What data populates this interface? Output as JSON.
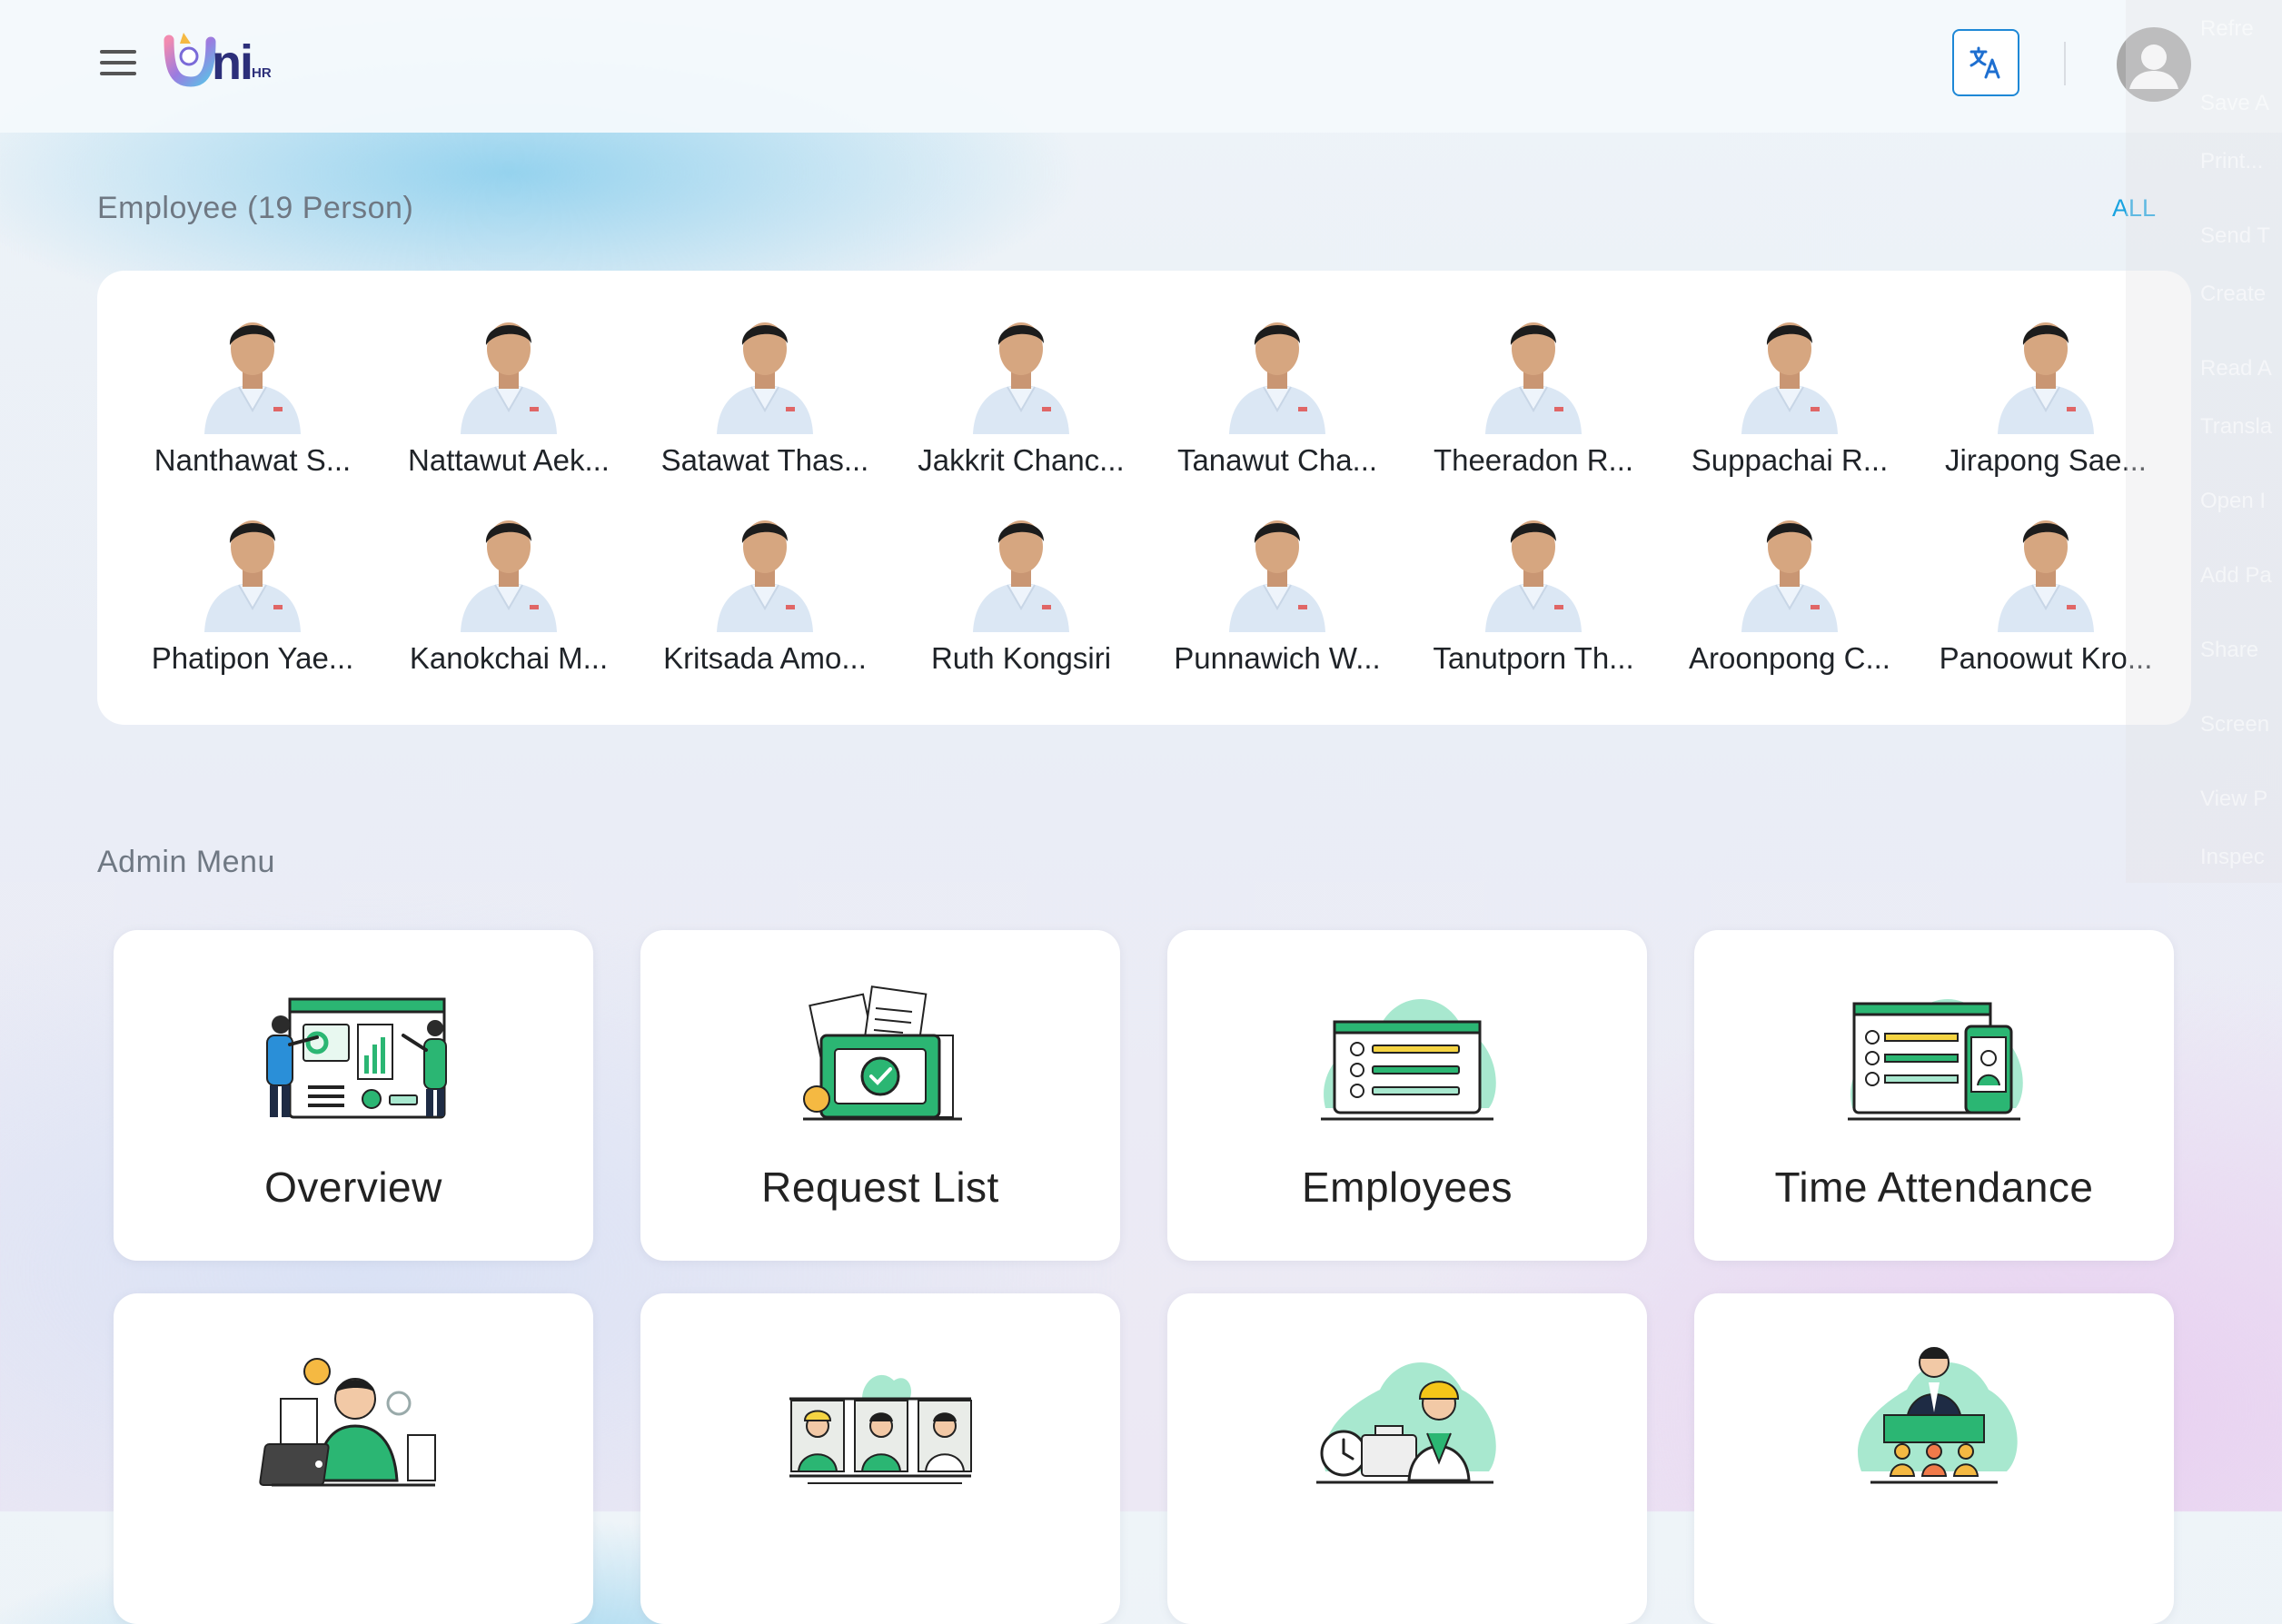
{
  "header": {
    "menu_icon": "hamburger-menu-icon",
    "logo_text": "ni",
    "logo_sub": "HR",
    "language_icon": "translate-icon",
    "profile_icon": "user-avatar-icon"
  },
  "employees_section": {
    "title": "Employee (19 Person)",
    "all_label": "ALL",
    "employees": [
      {
        "name": "Nanthawat S..."
      },
      {
        "name": "Nattawut Aek..."
      },
      {
        "name": "Satawat Thas..."
      },
      {
        "name": "Jakkrit Chanc..."
      },
      {
        "name": "Tanawut Cha..."
      },
      {
        "name": "Theeradon R..."
      },
      {
        "name": "Suppachai R..."
      },
      {
        "name": "Jirapong Sae..."
      },
      {
        "name": "Phatipon Yae..."
      },
      {
        "name": "Kanokchai M..."
      },
      {
        "name": "Kritsada Amo..."
      },
      {
        "name": "Ruth Kongsiri"
      },
      {
        "name": "Punnawich W..."
      },
      {
        "name": "Tanutporn Th..."
      },
      {
        "name": "Aroonpong C..."
      },
      {
        "name": "Panoowut Kro..."
      }
    ]
  },
  "admin_menu": {
    "title": "Admin Menu",
    "items": [
      {
        "label": "Overview",
        "icon": "overview-dashboard-illustration"
      },
      {
        "label": "Request List",
        "icon": "request-list-folder-illustration"
      },
      {
        "label": "Employees",
        "icon": "employees-list-illustration"
      },
      {
        "label": "Time Attendance",
        "icon": "time-attendance-illustration"
      },
      {
        "label": "",
        "icon": "working-at-laptop-illustration"
      },
      {
        "label": "",
        "icon": "employee-profiles-illustration"
      },
      {
        "label": "",
        "icon": "worker-time-illustration"
      },
      {
        "label": "",
        "icon": "manager-team-illustration"
      }
    ]
  },
  "context_menu": {
    "items": [
      "Refre",
      "Save A",
      "Print...",
      "Send T",
      "Create",
      "Read A",
      "Transla",
      "Open I",
      "Add Pa",
      "Share",
      "Screen",
      "View P",
      "Inspec"
    ]
  },
  "colors": {
    "accent": "#1aa3e0",
    "illustration_green": "#2bb673",
    "illustration_mint": "#a8e8cf",
    "shirt": "#dbe7f4"
  }
}
